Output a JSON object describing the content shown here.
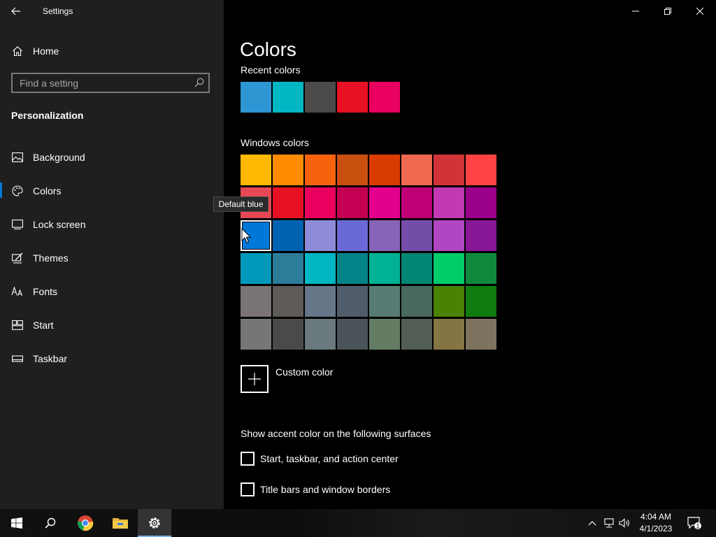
{
  "window": {
    "title": "Settings"
  },
  "sidebar": {
    "home_label": "Home",
    "search_placeholder": "Find a setting",
    "section_title": "Personalization",
    "items": [
      {
        "label": "Background",
        "icon": "image-icon"
      },
      {
        "label": "Colors",
        "icon": "palette-icon",
        "active": true
      },
      {
        "label": "Lock screen",
        "icon": "lock-screen-icon"
      },
      {
        "label": "Themes",
        "icon": "brush-icon"
      },
      {
        "label": "Fonts",
        "icon": "fonts-icon"
      },
      {
        "label": "Start",
        "icon": "start-icon"
      },
      {
        "label": "Taskbar",
        "icon": "taskbar-icon"
      }
    ]
  },
  "main": {
    "title": "Colors",
    "recent_label": "Recent colors",
    "recent_colors": [
      "#2d96d3",
      "#00b7c3",
      "#4c4a48",
      "#e81123",
      "#ea005e"
    ],
    "windows_label": "Windows colors",
    "windows_colors": [
      [
        "#ffb900",
        "#ff8c00",
        "#f7630c",
        "#ca5010",
        "#da3b01",
        "#ef6950",
        "#d13438",
        "#ff4343"
      ],
      [
        "#e74856",
        "#e81123",
        "#ea005e",
        "#c30052",
        "#e3008c",
        "#bf0077",
        "#c239b3",
        "#9a0089"
      ],
      [
        "#0078d7",
        "#0063b1",
        "#8e8cd8",
        "#6b69d6",
        "#8764b8",
        "#744da9",
        "#b146c2",
        "#881798"
      ],
      [
        "#0099bc",
        "#2d7d9a",
        "#00b7c3",
        "#038387",
        "#00b294",
        "#018574",
        "#00cc6a",
        "#10893e"
      ],
      [
        "#7a7574",
        "#5d5a58",
        "#68768a",
        "#515c6b",
        "#567c73",
        "#486860",
        "#498205",
        "#107c10"
      ],
      [
        "#767676",
        "#4c4a48",
        "#69797e",
        "#4a5459",
        "#647c64",
        "#525e54",
        "#847545",
        "#7e735f"
      ]
    ],
    "tooltip": "Default blue",
    "custom_color_label": "Custom color",
    "surfaces_label": "Show accent color on the following surfaces",
    "checkboxes": [
      {
        "label": "Start, taskbar, and action center",
        "checked": false
      },
      {
        "label": "Title bars and window borders",
        "checked": false
      }
    ]
  },
  "taskbar": {
    "time": "4:04 AM",
    "date": "4/1/2023",
    "notification_count": "1"
  }
}
